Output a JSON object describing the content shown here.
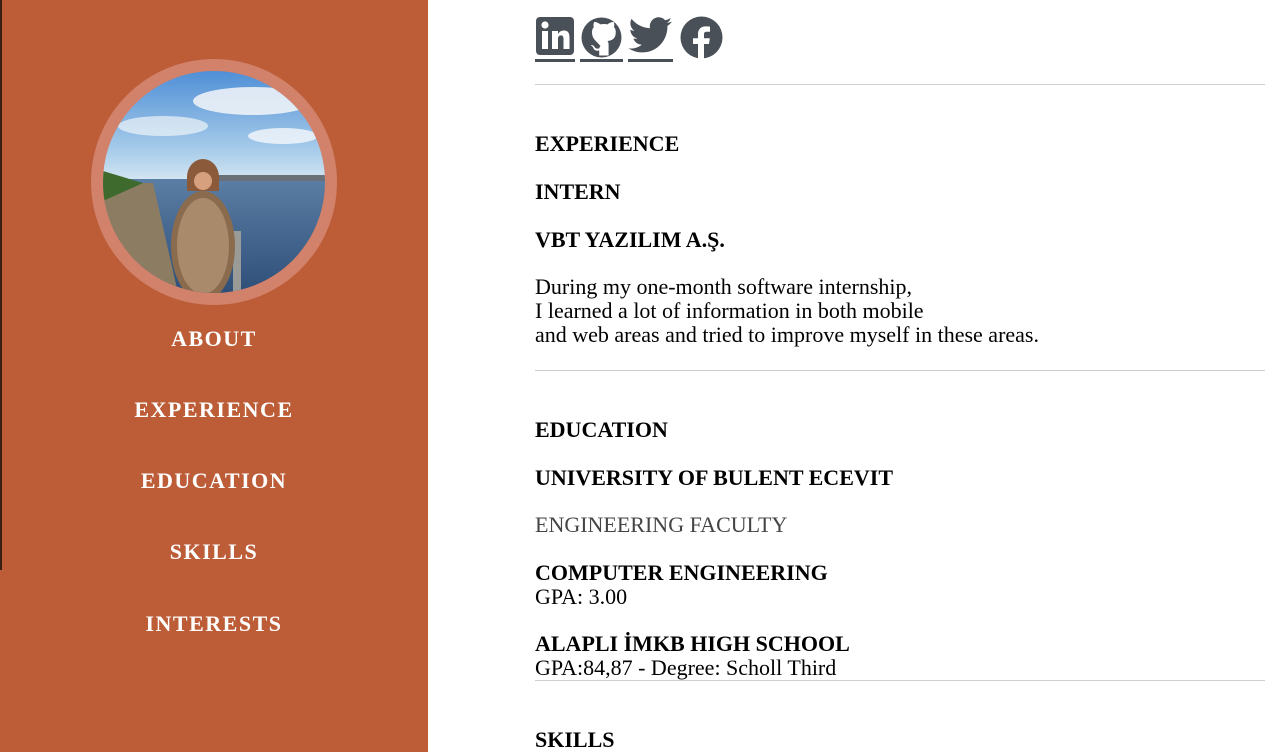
{
  "sidebar": {
    "avatar_alt": "profile photo",
    "nav": [
      {
        "label": "ABOUT"
      },
      {
        "label": "EXPERIENCE"
      },
      {
        "label": "EDUCATION"
      },
      {
        "label": "SKILLS"
      },
      {
        "label": "INTERESTS"
      }
    ]
  },
  "social": [
    {
      "icon": "linkedin-icon"
    },
    {
      "icon": "github-icon"
    },
    {
      "icon": "twitter-icon"
    },
    {
      "icon": "facebook-icon"
    }
  ],
  "experience": {
    "heading": "EXPERIENCE",
    "role": "INTERN",
    "company": "VBT YAZILIM A.Ş.",
    "lines": [
      "During my one-month software internship,",
      "I learned a lot of information in both mobile",
      "and web areas and tried to improve myself in these areas."
    ]
  },
  "education": {
    "heading": "EDUCATION",
    "university": "UNIVERSITY OF BULENT ECEVIT",
    "faculty": "ENGINEERING FACULTY",
    "department": "COMPUTER ENGINEERING",
    "gpa": "GPA: 3.00",
    "highschool": "ALAPLI İMKB HIGH SCHOOL",
    "hs_detail": "GPA:84,87 - Degree: Scholl Third"
  },
  "skills": {
    "heading": "SKILLS"
  },
  "colors": {
    "sidebar": "#bd5d38",
    "icon": "#495057"
  }
}
